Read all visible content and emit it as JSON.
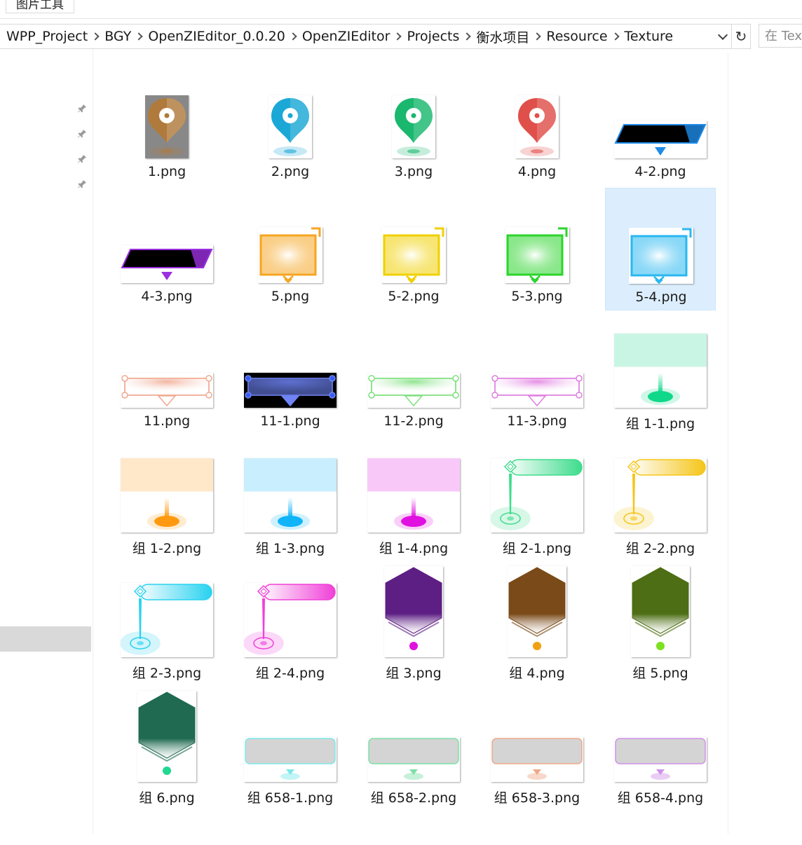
{
  "ribbon": {
    "tab_label": "图片工具"
  },
  "address": {
    "crumbs": [
      "WPP_Project",
      "BGY",
      "OpenZIEditor_0.0.20",
      "OpenZIEditor",
      "Projects",
      "衡水项目",
      "Resource",
      "Texture"
    ],
    "refresh_glyph": "↻",
    "dropdown_icon": "chevron-down-icon"
  },
  "search": {
    "placeholder": "在 Texture"
  },
  "files": [
    {
      "name": "1.png",
      "kind": "pin",
      "color": "#b07a3c"
    },
    {
      "name": "2.png",
      "kind": "pin",
      "color": "#1ba8d6"
    },
    {
      "name": "3.png",
      "kind": "pin",
      "color": "#1ab86e"
    },
    {
      "name": "4.png",
      "kind": "pin",
      "color": "#e0504a"
    },
    {
      "name": "4-2.png",
      "kind": "banner",
      "color": "#1e8be8"
    },
    {
      "name": "4-3.png",
      "kind": "banner",
      "color": "#9b30e0"
    },
    {
      "name": "5.png",
      "kind": "card",
      "color": "#f5a623"
    },
    {
      "name": "5-2.png",
      "kind": "card",
      "color": "#f0d000"
    },
    {
      "name": "5-3.png",
      "kind": "card",
      "color": "#2bd42b"
    },
    {
      "name": "5-4.png",
      "kind": "card",
      "color": "#29b8f0"
    },
    {
      "name": "11.png",
      "kind": "ribbonbar",
      "color": "#f0a890"
    },
    {
      "name": "11-1.png",
      "kind": "ribbonbar-dark",
      "color": "#6f84f5"
    },
    {
      "name": "11-2.png",
      "kind": "ribbonbar",
      "color": "#7de07d"
    },
    {
      "name": "11-3.png",
      "kind": "ribbonbar",
      "color": "#e07de0"
    },
    {
      "name": "组 1-1.png",
      "kind": "beacon",
      "color": "#10d88a"
    },
    {
      "name": "组 1-2.png",
      "kind": "beacon",
      "color": "#ff9a10"
    },
    {
      "name": "组 1-3.png",
      "kind": "beacon",
      "color": "#10b4f8"
    },
    {
      "name": "组 1-4.png",
      "kind": "beacon",
      "color": "#e010e0"
    },
    {
      "name": "组 2-1.png",
      "kind": "leader",
      "color": "#3ddc8c"
    },
    {
      "name": "组 2-2.png",
      "kind": "leader",
      "color": "#f5c518"
    },
    {
      "name": "组 2-3.png",
      "kind": "leader",
      "color": "#28d2f0"
    },
    {
      "name": "组 2-4.png",
      "kind": "leader",
      "color": "#f040d8"
    },
    {
      "name": "组 3.png",
      "kind": "hex",
      "color": "#5e1f84",
      "dot": "#e010e0"
    },
    {
      "name": "组 4.png",
      "kind": "hex",
      "color": "#7a4a18",
      "dot": "#f0a010"
    },
    {
      "name": "组 5.png",
      "kind": "hex",
      "color": "#4d6e14",
      "dot": "#7de020"
    },
    {
      "name": "组 6.png",
      "kind": "hex",
      "color": "#1f6a50",
      "dot": "#20d890"
    },
    {
      "name": "组 658-1.png",
      "kind": "plate",
      "color": "#7de8ea"
    },
    {
      "name": "组 658-2.png",
      "kind": "plate",
      "color": "#7de0a8"
    },
    {
      "name": "组 658-3.png",
      "kind": "plate",
      "color": "#f0a888"
    },
    {
      "name": "组 658-4.png",
      "kind": "plate",
      "color": "#d090e8"
    }
  ],
  "selected_file": "5-4.png",
  "colors": {
    "selection_bg": "#dceefd",
    "nav_selected_bg": "#d9d9d9"
  }
}
